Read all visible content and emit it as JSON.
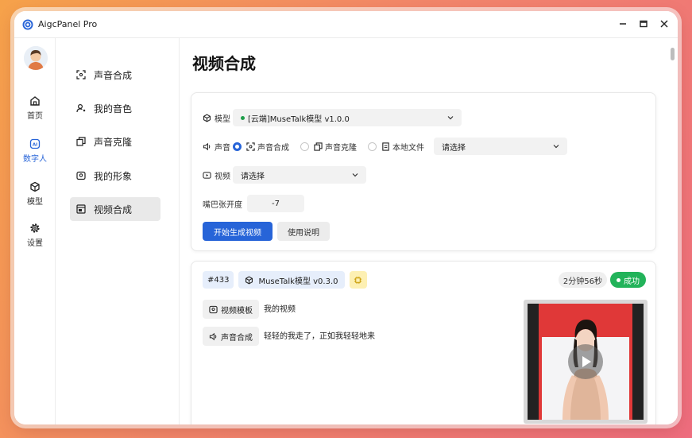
{
  "app": {
    "title": "AigcPanel Pro"
  },
  "nav": {
    "items": [
      {
        "label": "首页",
        "icon": "home-icon"
      },
      {
        "label": "数字人",
        "icon": "ai-icon",
        "active": true
      },
      {
        "label": "模型",
        "icon": "cube-icon"
      },
      {
        "label": "设置",
        "icon": "gear-icon"
      }
    ]
  },
  "subnav": {
    "items": [
      {
        "label": "声音合成",
        "icon": "scan-icon"
      },
      {
        "label": "我的音色",
        "icon": "user-voice-icon"
      },
      {
        "label": "声音克隆",
        "icon": "copy-icon"
      },
      {
        "label": "我的形象",
        "icon": "portrait-icon"
      },
      {
        "label": "视频合成",
        "icon": "video-compose-icon",
        "active": true
      }
    ]
  },
  "page": {
    "title": "视频合成"
  },
  "form": {
    "model_label": "模型",
    "model_value": "[云端]MuseTalk模型 v1.0.0",
    "voice_label": "声音",
    "voice_options": [
      "声音合成",
      "声音克隆",
      "本地文件"
    ],
    "voice_select_placeholder": "请选择",
    "video_label": "视频",
    "video_select_placeholder": "请选择",
    "mouth_label": "嘴巴张开度",
    "mouth_value": "-7",
    "start_button": "开始生成视频",
    "help_button": "使用说明"
  },
  "task": {
    "id": "#433",
    "model": "MuseTalk模型 v0.3.0",
    "duration": "2分钟56秒",
    "status": "成功",
    "video_tag": "视频模板",
    "video_value": "我的视频",
    "voice_tag": "声音合成",
    "voice_value": "轻轻的我走了，正如我轻轻地来"
  },
  "colors": {
    "accent": "#2764d8",
    "success": "#22b35a",
    "video_bg": "#e03838"
  }
}
